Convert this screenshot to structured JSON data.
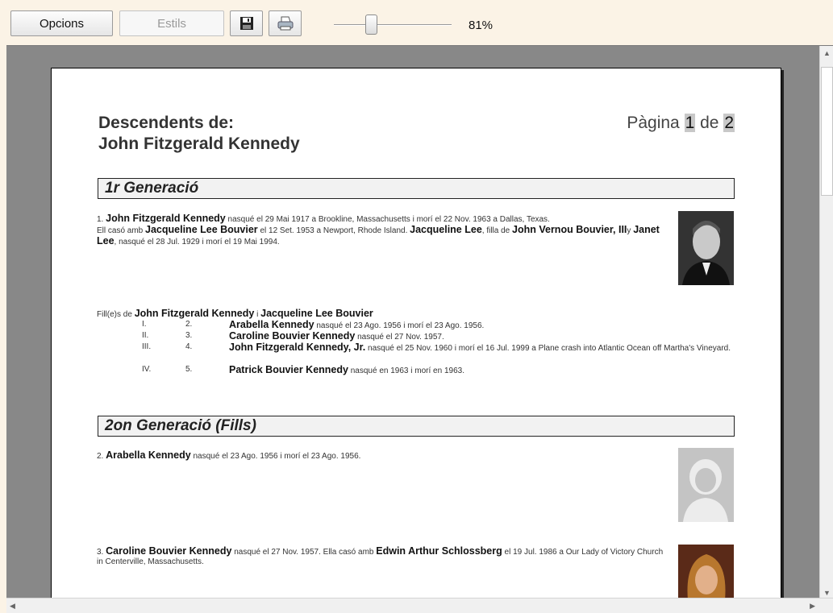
{
  "toolbar": {
    "options_label": "Opcions",
    "styles_label": "Estils",
    "save_icon": "save-icon",
    "print_icon": "print-icon",
    "zoom": "81%"
  },
  "page": {
    "title_line1": "Descendents de:",
    "title_line2": "John Fitzgerald Kennedy",
    "page_word": "Pàgina",
    "page_current": "1",
    "page_of": "de",
    "page_total": "2"
  },
  "gen1": {
    "heading": "1r Generació",
    "person": {
      "num": "1.",
      "name": "John Fitzgerald Kennedy",
      "t1": "nasqué el 29 Mai 1917 a Brookline, Massachusetts i morí el 22 Nov. 1963 a Dallas, Texas.",
      "t2": "Ell casó amb",
      "spouse": "Jacqueline Lee Bouvier",
      "t3": "el 12 Set. 1953 a Newport, Rhode Island.",
      "spouse_short": "Jacqueline Lee",
      "t4": ", filla de",
      "father": "John Vernou Bouvier, III",
      "t5": "y",
      "mother": "Janet Lee",
      "t6": ", nasqué el 28 Jul. 1929 i morí el 19 Mai 1994."
    },
    "children_intro": "Fill(e)s de",
    "children_parent1": "John Fitzgerald Kennedy",
    "children_and": "i",
    "children_parent2": "Jacqueline Lee Bouvier",
    "children": [
      {
        "roman": "I.",
        "num": "2.",
        "name": "Arabella Kennedy",
        "text": "nasqué el 23 Ago. 1956 i morí el 23 Ago. 1956."
      },
      {
        "roman": "II.",
        "num": "3.",
        "name": "Caroline Bouvier Kennedy",
        "text": "nasqué el 27 Nov. 1957."
      },
      {
        "roman": "III.",
        "num": "4.",
        "name": "John Fitzgerald Kennedy, Jr.",
        "text": "nasqué el 25 Nov. 1960 i morí el 16 Jul. 1999 a Plane crash into Atlantic Ocean off Martha's Vineyard."
      },
      {
        "roman": "IV.",
        "num": "5.",
        "name": "Patrick Bouvier Kennedy",
        "text": "nasqué en 1963 i morí en 1963."
      }
    ]
  },
  "gen2": {
    "heading": "2on Generació (Fills)",
    "p2": {
      "num": "2.",
      "name": "Arabella Kennedy",
      "text": "nasqué el 23 Ago. 1956 i morí el 23 Ago. 1956."
    },
    "p3": {
      "num": "3.",
      "name": "Caroline Bouvier Kennedy",
      "t1": "nasqué el 27 Nov. 1957.  Ella casó amb",
      "spouse": "Edwin Arthur Schlossberg",
      "t2": "el 19 Jul. 1986 a Our Lady of Victory Church in Centerville, Massachusetts."
    }
  },
  "colors": {
    "accent_bg": "#fbf3e6",
    "viewport": "#888888",
    "heading_bg": "#f2f2f2"
  }
}
